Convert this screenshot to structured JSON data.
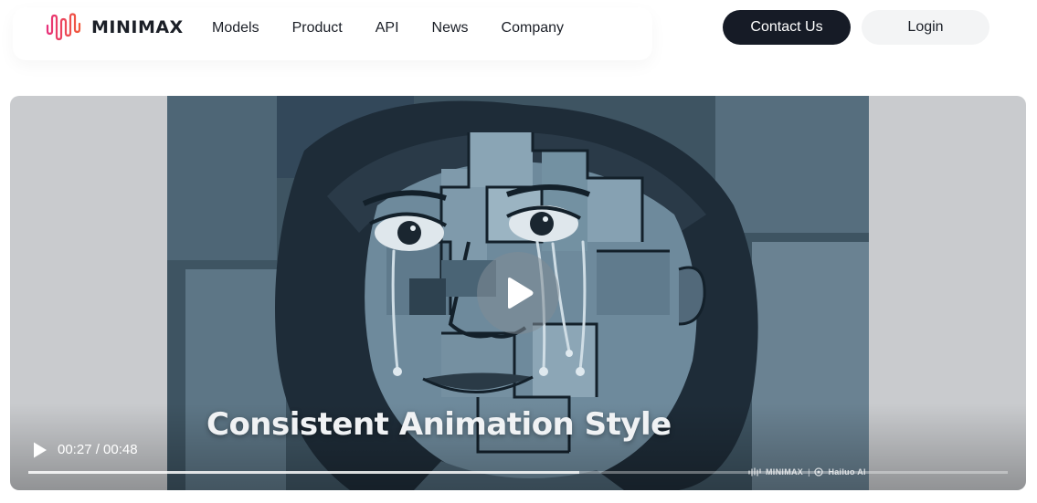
{
  "brand": {
    "name": "MINIMAX",
    "accent_start": "#e8317a",
    "accent_end": "#f05a3c"
  },
  "nav": {
    "items": [
      "Models",
      "Product",
      "API",
      "News",
      "Company"
    ]
  },
  "actions": {
    "contact_label": "Contact Us",
    "login_label": "Login"
  },
  "video": {
    "caption": "Consistent Animation Style",
    "current_time": "00:27",
    "duration": "00:48",
    "time_display": "00:27 / 00:48",
    "progress": 0.5625,
    "watermark_brand": "MINIMAX",
    "watermark_separator": "|",
    "watermark_product": "Hailuo AI"
  }
}
